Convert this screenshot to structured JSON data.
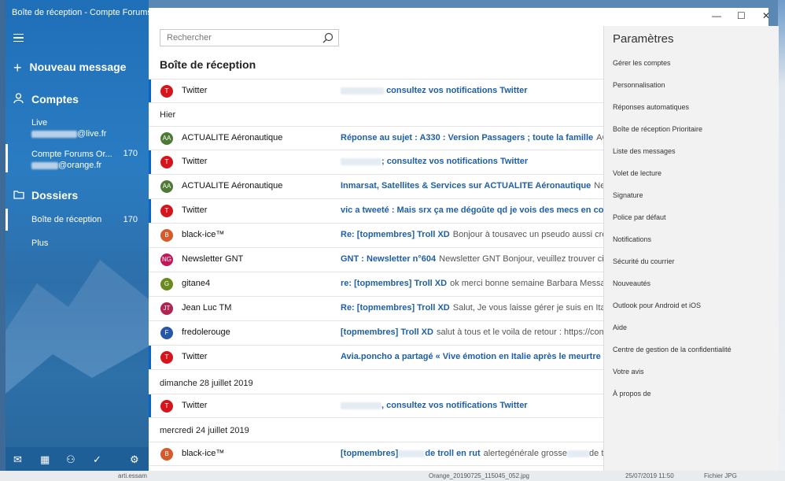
{
  "window": {
    "title": "Boîte de réception - Compte Forums Orange"
  },
  "left": {
    "new_message": "Nouveau message",
    "accounts_header": "Comptes",
    "accounts": [
      {
        "name": "Live",
        "email_suffix": "@live.fr"
      },
      {
        "name": "Compte Forums Or...",
        "count": "170",
        "email_suffix": "@orange.fr"
      }
    ],
    "folders_header": "Dossiers",
    "folders": [
      {
        "label": "Boîte de réception",
        "count": "170"
      },
      {
        "label": "Plus"
      }
    ]
  },
  "search": {
    "placeholder": "Rechercher"
  },
  "list": {
    "title": "Boîte de réception",
    "rows": [
      {
        "initials": "T",
        "color": "#d6141c",
        "sender": "Twitter",
        "subject": "consultez vos notifications Twitter",
        "preview": ""
      },
      {
        "initials": "AA",
        "color": "#4e7a35",
        "sender": "ACTUALITE  Aéronautique",
        "subject": "Réponse au sujet : A330 : Version Passagers ; toute la famille",
        "preview": "ACTUALITE"
      },
      {
        "initials": "T",
        "color": "#d6141c",
        "sender": "Twitter",
        "subject": "; consultez vos notifications Twitter",
        "preview": ""
      },
      {
        "initials": "AA",
        "color": "#4e7a35",
        "sender": "ACTUALITE  Aéronautique",
        "subject": "Inmarsat, Satellites & Services sur ACTUALITE  Aéronautique",
        "preview": "Newsletter"
      },
      {
        "initials": "T",
        "color": "#d6141c",
        "sender": "Twitter",
        "subject": "vic a tweeté : Mais srx ça me dégoûte qd je vois des mecs en couple ...",
        "preview": ""
      },
      {
        "initials": "B",
        "color": "#d65a2a",
        "sender": "black-ice™",
        "subject": "Re: [topmembres] Troll XD",
        "preview": "Bonjour à tousavec un pseudo aussi crétin e"
      },
      {
        "initials": "NG",
        "color": "#c2185b",
        "sender": "Newsletter GNT",
        "subject": "GNT : Newsletter n°604",
        "preview": "Newsletter GNT Bonjour, veuillez trouver ci-des"
      },
      {
        "initials": "G",
        "color": "#6a8a1f",
        "sender": "gitane4",
        "subject": "re: [topmembres] Troll XD",
        "preview": "ok merci bonne semaine Barbara Message de"
      },
      {
        "initials": "JT",
        "color": "#b0244f",
        "sender": "Jean Luc TM",
        "subject": "Re: [topmembres] Troll XD",
        "preview": "Salut, Je vous laisse gérer je suis en Italie Le"
      },
      {
        "initials": "F",
        "color": "#2856a8",
        "sender": "fredolerouge",
        "subject": "[topmembres] Troll XD",
        "preview": "salut à tous et le voila de retour : https://commu"
      },
      {
        "initials": "T",
        "color": "#d6141c",
        "sender": "Twitter",
        "subject": "Avia.poncho a partagé « Vive émotion en Italie après le meurtre sord...",
        "preview": ""
      },
      {
        "initials": "T",
        "color": "#d6141c",
        "sender": "Twitter",
        "subject": ", consultez vos notifications Twitter",
        "preview": ""
      },
      {
        "initials": "B",
        "color": "#d65a2a",
        "sender": "black-ice™",
        "subject": "[topmembres]",
        "subject2": "de troll en rut",
        "preview": "alertegénérale grosse",
        "preview2": "de troll"
      }
    ],
    "groups": [
      "Hier",
      "dimanche 28 juillet 2019",
      "mercredi 24 juillet 2019"
    ]
  },
  "settings": {
    "title": "Paramètres",
    "items": [
      "Gérer les comptes",
      "Personnalisation",
      "Réponses automatiques",
      "Boîte de réception Prioritaire",
      "Liste des messages",
      "Volet de lecture",
      "Signature",
      "Police par défaut",
      "Notifications",
      "Sécurité du courrier",
      "Nouveautés",
      "Outlook pour Android et iOS",
      "Aide",
      "Centre de gestion de la confidentialité",
      "Votre avis",
      "À propos de"
    ]
  },
  "window_controls": {
    "minimize": "—",
    "maximize": "☐",
    "close": "✕"
  },
  "taskbar": {
    "left_text": "arti.essam",
    "right_file": "Orange_20190725_115045_052.jpg",
    "right_date": "25/07/2019 11:50",
    "right_type": "Fichier JPG"
  }
}
